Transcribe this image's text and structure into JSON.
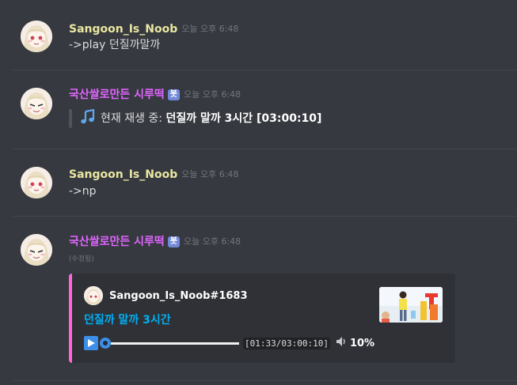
{
  "messages": [
    {
      "username": "Sangoon_Is_Noob",
      "timestamp": "오늘 오후 6:48",
      "content": "->play 던질까말까"
    },
    {
      "username": "국산쌀로만든 시루떡",
      "bot_tag": "봇",
      "timestamp": "오늘 오후 6:48",
      "quote_prefix": "현재 재생 중: ",
      "quote_bold": "던질까 말까 3시간 [03:00:10]"
    },
    {
      "username": "Sangoon_Is_Noob",
      "timestamp": "오늘 오후 6:48",
      "content": "->np"
    },
    {
      "username": "국산쌀로만든 시루떡",
      "bot_tag": "봇",
      "timestamp": "오늘 오후 6:48",
      "edited": "(수정됨)",
      "embed": {
        "author": "Sangoon_Is_Noob#1683",
        "title": "던질까 말까 3시간",
        "time_code": "[01:33/03:00:10]",
        "volume": "10%",
        "progress": 0.0086
      }
    }
  ],
  "colors": {
    "background": "#36393f",
    "embed_background": "#2f3136",
    "embed_accent": "#ff66d9",
    "user_color": "#e9e7a2",
    "bot_color": "#e066ff",
    "link_color": "#00b0f4",
    "bot_tag": "#7289da"
  },
  "icons": {
    "note": "musical-note-icon",
    "play": "play-icon",
    "volume": "speaker-icon"
  }
}
